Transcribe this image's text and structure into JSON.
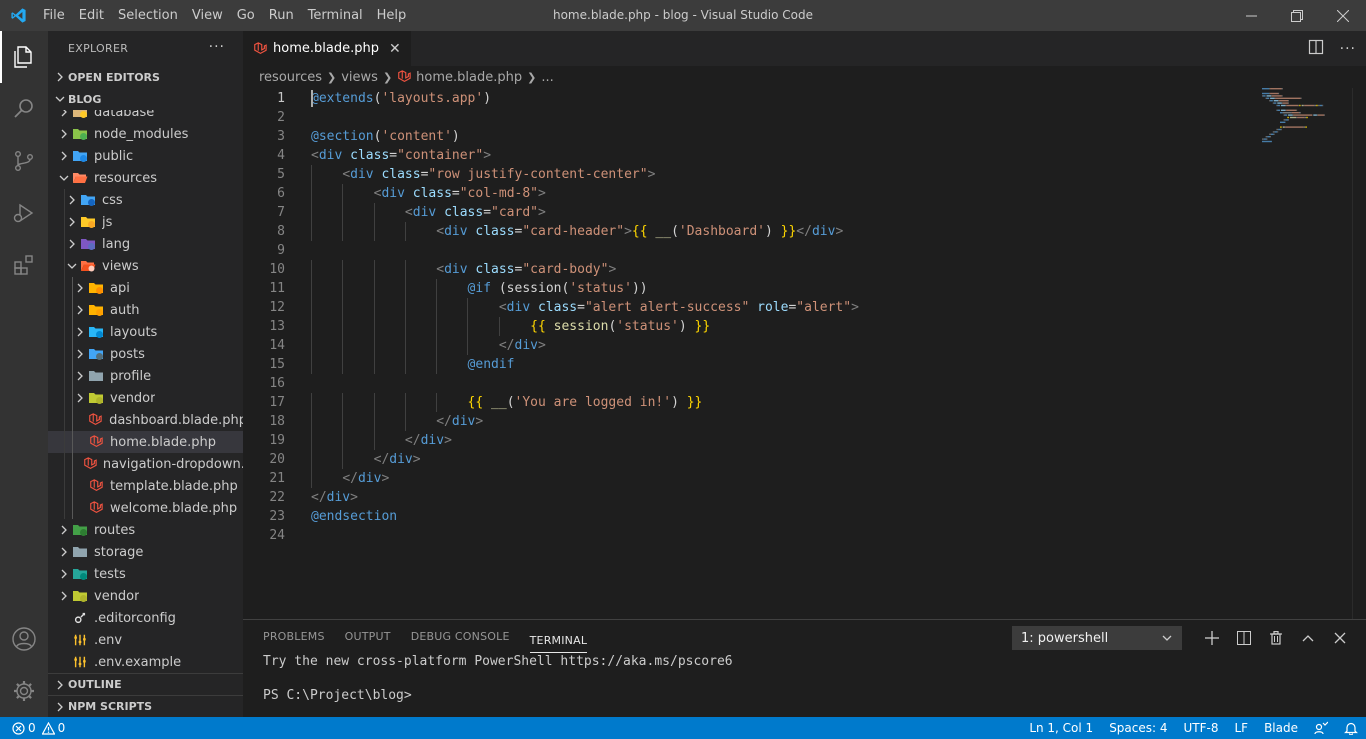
{
  "window": {
    "title": "home.blade.php - blog - Visual Studio Code",
    "menu": [
      "File",
      "Edit",
      "Selection",
      "View",
      "Go",
      "Run",
      "Terminal",
      "Help"
    ]
  },
  "colors": {
    "accent": "#007acc",
    "activity_bar": "#333333",
    "sidebar": "#252526",
    "editor": "#1e1e1e",
    "laravel_icon": "#f05340"
  },
  "activity_bar": {
    "items": [
      "explorer-icon",
      "search-icon",
      "source-control-icon",
      "run-debug-icon",
      "extensions-icon"
    ],
    "bottom": [
      "account-icon",
      "manage-gear-icon"
    ]
  },
  "sidebar": {
    "title": "EXPLORER",
    "more": "···",
    "open_editors": "OPEN EDITORS",
    "project": "BLOG",
    "outline": "OUTLINE",
    "npm_scripts": "NPM SCRIPTS",
    "tree": [
      {
        "label": "database",
        "depth": 0,
        "type": "folder",
        "icon": "folder-database-icon",
        "expanded": false
      },
      {
        "label": "node_modules",
        "depth": 0,
        "type": "folder",
        "icon": "folder-node-icon",
        "expanded": false
      },
      {
        "label": "public",
        "depth": 0,
        "type": "folder",
        "icon": "folder-public-icon",
        "expanded": false
      },
      {
        "label": "resources",
        "depth": 0,
        "type": "folder",
        "icon": "folder-open-icon",
        "expanded": true
      },
      {
        "label": "css",
        "depth": 1,
        "type": "folder",
        "icon": "folder-css-icon",
        "expanded": false
      },
      {
        "label": "js",
        "depth": 1,
        "type": "folder",
        "icon": "folder-js-icon",
        "expanded": false
      },
      {
        "label": "lang",
        "depth": 1,
        "type": "folder",
        "icon": "folder-lang-icon",
        "expanded": false
      },
      {
        "label": "views",
        "depth": 1,
        "type": "folder",
        "icon": "folder-views-icon",
        "expanded": true
      },
      {
        "label": "api",
        "depth": 2,
        "type": "folder",
        "icon": "folder-api-icon",
        "expanded": false
      },
      {
        "label": "auth",
        "depth": 2,
        "type": "folder",
        "icon": "folder-auth-icon",
        "expanded": false
      },
      {
        "label": "layouts",
        "depth": 2,
        "type": "folder",
        "icon": "folder-layouts-icon",
        "expanded": false
      },
      {
        "label": "posts",
        "depth": 2,
        "type": "folder",
        "icon": "folder-posts-icon",
        "expanded": false
      },
      {
        "label": "profile",
        "depth": 2,
        "type": "folder",
        "icon": "folder-icon",
        "expanded": false
      },
      {
        "label": "vendor",
        "depth": 2,
        "type": "folder",
        "icon": "folder-vendor-icon",
        "expanded": false
      },
      {
        "label": "dashboard.blade.php",
        "depth": 2,
        "type": "file",
        "icon": "laravel-blade-icon"
      },
      {
        "label": "home.blade.php",
        "depth": 2,
        "type": "file",
        "icon": "laravel-blade-icon",
        "selected": true
      },
      {
        "label": "navigation-dropdown.blade.php",
        "depth": 2,
        "type": "file",
        "icon": "laravel-blade-icon"
      },
      {
        "label": "template.blade.php",
        "depth": 2,
        "type": "file",
        "icon": "laravel-blade-icon"
      },
      {
        "label": "welcome.blade.php",
        "depth": 2,
        "type": "file",
        "icon": "laravel-blade-icon"
      },
      {
        "label": "routes",
        "depth": 0,
        "type": "folder",
        "icon": "folder-routes-icon",
        "expanded": false
      },
      {
        "label": "storage",
        "depth": 0,
        "type": "folder",
        "icon": "folder-icon",
        "expanded": false
      },
      {
        "label": "tests",
        "depth": 0,
        "type": "folder",
        "icon": "folder-tests-icon",
        "expanded": false
      },
      {
        "label": "vendor",
        "depth": 0,
        "type": "folder",
        "icon": "folder-vendor-icon",
        "expanded": false
      },
      {
        "label": ".editorconfig",
        "depth": 0,
        "type": "file",
        "icon": "editorconfig-icon"
      },
      {
        "label": ".env",
        "depth": 0,
        "type": "file",
        "icon": "env-icon"
      },
      {
        "label": ".env.example",
        "depth": 0,
        "type": "file",
        "icon": "env-icon"
      }
    ]
  },
  "editor": {
    "tab": {
      "label": "home.blade.php",
      "close": "✕"
    },
    "breadcrumb": [
      "resources",
      "views",
      "home.blade.php",
      "..."
    ],
    "lines": [
      [
        [
          "kw",
          "@extends"
        ],
        [
          "t",
          "("
        ],
        [
          "str",
          "'layouts.app'"
        ],
        [
          "t",
          ")"
        ]
      ],
      [],
      [
        [
          "kw",
          "@section"
        ],
        [
          "t",
          "("
        ],
        [
          "str",
          "'content'"
        ],
        [
          "t",
          ")"
        ]
      ],
      [
        [
          "br",
          "<"
        ],
        [
          "tag",
          "div"
        ],
        [
          "t",
          " "
        ],
        [
          "attr",
          "class"
        ],
        [
          "t",
          "="
        ],
        [
          "str",
          "\"container\""
        ],
        [
          "br",
          ">"
        ]
      ],
      [
        [
          "t",
          "    "
        ],
        [
          "br",
          "<"
        ],
        [
          "tag",
          "div"
        ],
        [
          "t",
          " "
        ],
        [
          "attr",
          "class"
        ],
        [
          "t",
          "="
        ],
        [
          "str",
          "\"row justify-content-center\""
        ],
        [
          "br",
          ">"
        ]
      ],
      [
        [
          "t",
          "        "
        ],
        [
          "br",
          "<"
        ],
        [
          "tag",
          "div"
        ],
        [
          "t",
          " "
        ],
        [
          "attr",
          "class"
        ],
        [
          "t",
          "="
        ],
        [
          "str",
          "\"col-md-8\""
        ],
        [
          "br",
          ">"
        ]
      ],
      [
        [
          "t",
          "            "
        ],
        [
          "br",
          "<"
        ],
        [
          "tag",
          "div"
        ],
        [
          "t",
          " "
        ],
        [
          "attr",
          "class"
        ],
        [
          "t",
          "="
        ],
        [
          "str",
          "\"card\""
        ],
        [
          "br",
          ">"
        ]
      ],
      [
        [
          "t",
          "                "
        ],
        [
          "br",
          "<"
        ],
        [
          "tag",
          "div"
        ],
        [
          "t",
          " "
        ],
        [
          "attr",
          "class"
        ],
        [
          "t",
          "="
        ],
        [
          "str",
          "\"card-header\""
        ],
        [
          "br",
          ">"
        ],
        [
          "brk",
          "{{"
        ],
        [
          "t",
          " "
        ],
        [
          "fn",
          "__"
        ],
        [
          "t",
          "("
        ],
        [
          "str",
          "'Dashboard'"
        ],
        [
          "t",
          ") "
        ],
        [
          "brk",
          "}}"
        ],
        [
          "br",
          "</"
        ],
        [
          "tag",
          "div"
        ],
        [
          "br",
          ">"
        ]
      ],
      [],
      [
        [
          "t",
          "                "
        ],
        [
          "br",
          "<"
        ],
        [
          "tag",
          "div"
        ],
        [
          "t",
          " "
        ],
        [
          "attr",
          "class"
        ],
        [
          "t",
          "="
        ],
        [
          "str",
          "\"card-body\""
        ],
        [
          "br",
          ">"
        ]
      ],
      [
        [
          "t",
          "                    "
        ],
        [
          "kw",
          "@if"
        ],
        [
          "t",
          " (session("
        ],
        [
          "str",
          "'status'"
        ],
        [
          "t",
          "))"
        ]
      ],
      [
        [
          "t",
          "                        "
        ],
        [
          "br",
          "<"
        ],
        [
          "tag",
          "div"
        ],
        [
          "t",
          " "
        ],
        [
          "attr",
          "class"
        ],
        [
          "t",
          "="
        ],
        [
          "str",
          "\"alert alert-success\""
        ],
        [
          "t",
          " "
        ],
        [
          "attr",
          "role"
        ],
        [
          "t",
          "="
        ],
        [
          "str",
          "\"alert\""
        ],
        [
          "br",
          ">"
        ]
      ],
      [
        [
          "t",
          "                            "
        ],
        [
          "brk",
          "{{"
        ],
        [
          "t",
          " "
        ],
        [
          "fn",
          "session"
        ],
        [
          "t",
          "("
        ],
        [
          "str",
          "'status'"
        ],
        [
          "t",
          ") "
        ],
        [
          "brk",
          "}}"
        ]
      ],
      [
        [
          "t",
          "                        "
        ],
        [
          "br",
          "</"
        ],
        [
          "tag",
          "div"
        ],
        [
          "br",
          ">"
        ]
      ],
      [
        [
          "t",
          "                    "
        ],
        [
          "kw",
          "@endif"
        ]
      ],
      [],
      [
        [
          "t",
          "                    "
        ],
        [
          "brk",
          "{{"
        ],
        [
          "t",
          " "
        ],
        [
          "fn",
          "__"
        ],
        [
          "t",
          "("
        ],
        [
          "str",
          "'You are logged in!'"
        ],
        [
          "t",
          ") "
        ],
        [
          "brk",
          "}}"
        ]
      ],
      [
        [
          "t",
          "                "
        ],
        [
          "br",
          "</"
        ],
        [
          "tag",
          "div"
        ],
        [
          "br",
          ">"
        ]
      ],
      [
        [
          "t",
          "            "
        ],
        [
          "br",
          "</"
        ],
        [
          "tag",
          "div"
        ],
        [
          "br",
          ">"
        ]
      ],
      [
        [
          "t",
          "        "
        ],
        [
          "br",
          "</"
        ],
        [
          "tag",
          "div"
        ],
        [
          "br",
          ">"
        ]
      ],
      [
        [
          "t",
          "    "
        ],
        [
          "br",
          "</"
        ],
        [
          "tag",
          "div"
        ],
        [
          "br",
          ">"
        ]
      ],
      [
        [
          "br",
          "</"
        ],
        [
          "tag",
          "div"
        ],
        [
          "br",
          ">"
        ]
      ],
      [
        [
          "kw",
          "@endsection"
        ]
      ],
      []
    ],
    "line_numbers": [
      "1",
      "2",
      "3",
      "4",
      "5",
      "6",
      "7",
      "8",
      "9",
      "10",
      "11",
      "12",
      "13",
      "14",
      "15",
      "16",
      "17",
      "18",
      "19",
      "20",
      "21",
      "22",
      "23",
      "24"
    ]
  },
  "panel": {
    "tabs": [
      "PROBLEMS",
      "OUTPUT",
      "DEBUG CONSOLE",
      "TERMINAL"
    ],
    "active_tab": "TERMINAL",
    "terminal_select": "1: powershell",
    "terminal_lines": [
      "Try the new cross-platform PowerShell https://aka.ms/pscore6",
      "",
      "PS C:\\Project\\blog>"
    ]
  },
  "statusbar": {
    "errors": "0",
    "warnings": "0",
    "position": "Ln 1, Col 1",
    "spaces": "Spaces: 4",
    "encoding": "UTF-8",
    "eol": "LF",
    "language": "Blade"
  }
}
